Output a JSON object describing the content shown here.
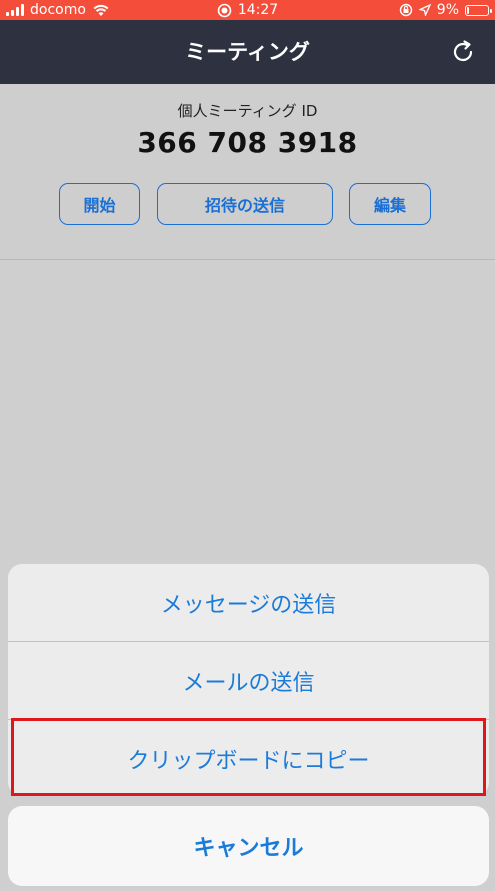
{
  "status_bar": {
    "carrier": "docomo",
    "time": "14:27",
    "battery_percent": "9%",
    "battery_level": 0.09
  },
  "nav": {
    "title": "ミーティング"
  },
  "meeting": {
    "id_label": "個人ミーティング ID",
    "id_value": "366 708 3918"
  },
  "buttons": {
    "start": "開始",
    "send_invite": "招待の送信",
    "edit": "編集"
  },
  "action_sheet": {
    "items": [
      "メッセージの送信",
      "メールの送信",
      "クリップボードにコピー"
    ],
    "cancel": "キャンセル",
    "highlight_color": "#e0161c"
  },
  "colors": {
    "status_bar": "#f44e3b",
    "nav_bar": "#2e3140",
    "accent": "#1a7bd9"
  }
}
